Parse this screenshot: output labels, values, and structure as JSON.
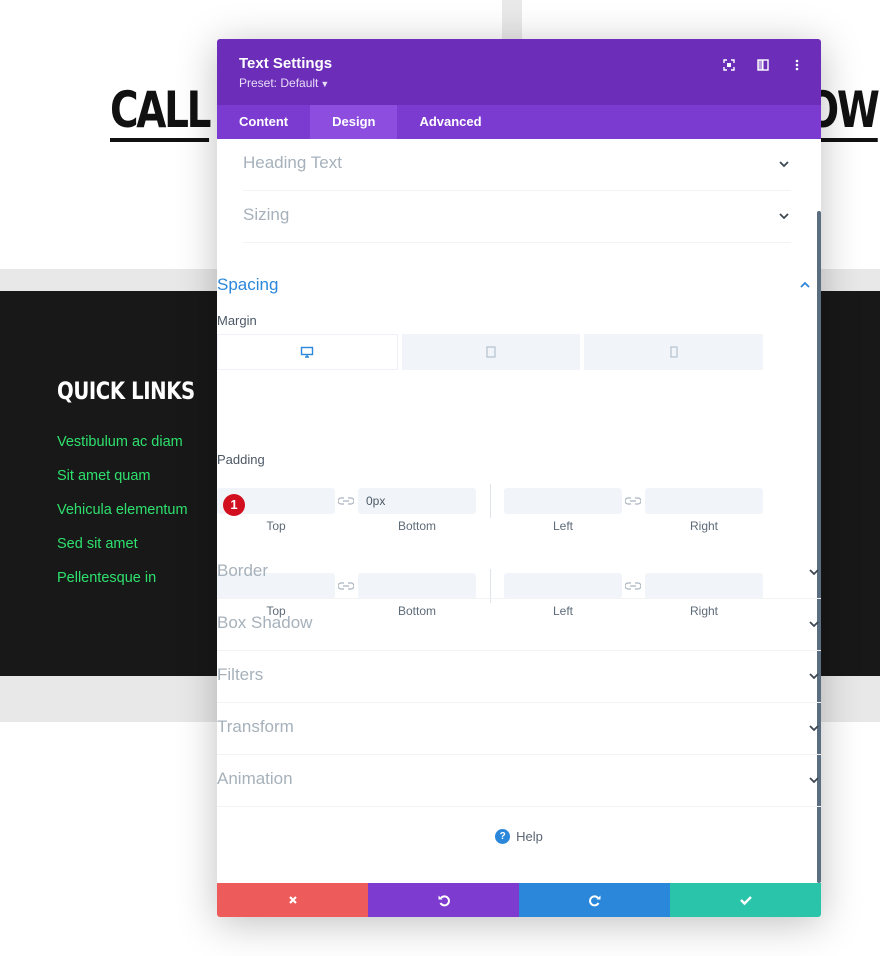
{
  "background": {
    "cta_left": "CALL",
    "cta_right": "OW",
    "quick_links_title": "QUICK LINKS",
    "quick_links": [
      "Vestibulum ac diam",
      "Sit amet quam",
      "Vehicula elementum",
      "Sed sit amet",
      "Pellentesque in"
    ]
  },
  "modal": {
    "title": "Text Settings",
    "preset": "Preset: Default",
    "tabs": [
      "Content",
      "Design",
      "Advanced"
    ],
    "active_tab": "Design",
    "groups_top": [
      "Heading Text",
      "Sizing"
    ],
    "spacing": {
      "title": "Spacing",
      "margin_label": "Margin",
      "padding_label": "Padding",
      "field_labels": [
        "Top",
        "Bottom",
        "Left",
        "Right"
      ],
      "margin_bottom_value": "0px"
    },
    "groups_bottom": [
      "Border",
      "Box Shadow",
      "Filters",
      "Transform",
      "Animation"
    ],
    "badge": "1",
    "help": "Help"
  },
  "colors": {
    "header": "#6c2eb9",
    "tabs": "#7b3bd1",
    "accent_link": "#2ee06d",
    "cancel": "#ee5b5b",
    "undo": "#7e3bd0",
    "redo": "#2b87da",
    "save": "#29c4a9"
  }
}
